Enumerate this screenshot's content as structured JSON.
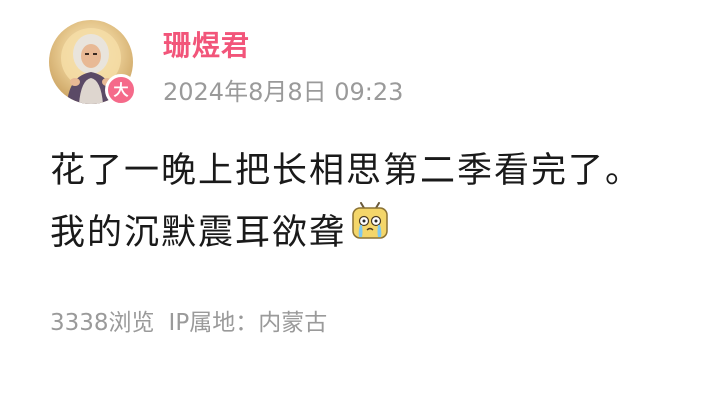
{
  "post": {
    "author": {
      "name": "珊煜君",
      "badge": "大"
    },
    "timestamp": "2024年8月8日 09:23",
    "content_lines": [
      "花了一晚上把长相思第二季看完了。",
      "我的沉默震耳欲聋"
    ],
    "emoji": "crying-tv-emoji",
    "stats": {
      "views": "3338浏览",
      "ip_location": "IP属地：内蒙古"
    }
  },
  "colors": {
    "username": "#f2557a",
    "badge": "#f56a8a",
    "meta": "#9a9a9a",
    "text": "#1a1a1a"
  }
}
